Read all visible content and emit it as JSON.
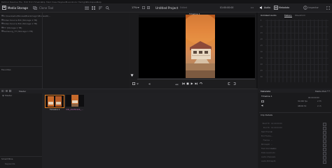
{
  "menubar": {
    "items": [
      "DaVinci Resolve",
      "File",
      "Edit",
      "Trim",
      "Timeline",
      "Clip",
      "Mark",
      "View",
      "Playback",
      "Fusion",
      "Color",
      "Fairlight",
      "Workspace",
      "Help"
    ]
  },
  "toolbar": {
    "media_storage_label": "Media Storage",
    "clone_tool_label": "Clone Tool",
    "zoom": "17%",
    "project_title": "Untitled Project",
    "project_status": "Edited",
    "timeline_name": "Timeline 1",
    "timecode": "01:00:00:00",
    "audio_label": "Audio",
    "metadata_label": "Metadata",
    "inspector_label": "Inspector"
  },
  "media_storage": {
    "paths": [
      "C:\\Users\\ehs\\Movies\\Blackmagic\\Movies\\R\\...",
      "Video Source Ext (Storage 1 TB)",
      "Video Source Ext (Storage 1 TB)",
      "T7 (Storage 1 TB)",
      "Samsung_T7 (Storage 1 TB)"
    ],
    "favorites_label": "Favorites"
  },
  "audio_panel": {
    "title": "Unlinked Audio",
    "tabs": [
      "Meters",
      "Waveform"
    ],
    "scale": [
      "-5",
      "-10",
      "-15",
      "-20",
      "-25",
      "-30",
      "-35",
      "-40",
      "-45",
      "-50"
    ]
  },
  "media_pool": {
    "header_label": "Master",
    "bins_label": "Master",
    "smart_bins_label": "Smart Bins",
    "smart_bins_item": "Keywords",
    "clips": [
      {
        "name": "Timeline 1"
      },
      {
        "name": "VID_20230424_..."
      }
    ]
  },
  "metadata": {
    "title": "Metadata",
    "pool_label": "Media Pool",
    "clip_name": "Timeline 1",
    "clip_timecode": "00:00:00:00",
    "rows": [
      {
        "left": "",
        "right": "30.000 fps"
      },
      {
        "left": "",
        "right": "2.75"
      },
      {
        "left": "",
        "right": "48000 Hz"
      },
      {
        "left": "",
        "right": "2 ch"
      }
    ],
    "section": "Clip Details",
    "details": [
      {
        "key": "Start TC",
        "value": "01:00:00:00"
      },
      {
        "key": "End TC",
        "value": "01:00:04:00"
      },
      {
        "key": "Start Frame",
        "value": "0"
      },
      {
        "key": "End Frame",
        "value": "--"
      },
      {
        "key": "Frames",
        "value": "--"
      },
      {
        "key": "Bit Depth",
        "value": "--"
      },
      {
        "key": "Field Dominance",
        "value": "Auto"
      },
      {
        "key": "Data Level",
        "value": "Auto"
      },
      {
        "key": "Audio Channels",
        "value": "--"
      },
      {
        "key": "Audio Bit Depth",
        "value": "--"
      }
    ]
  }
}
